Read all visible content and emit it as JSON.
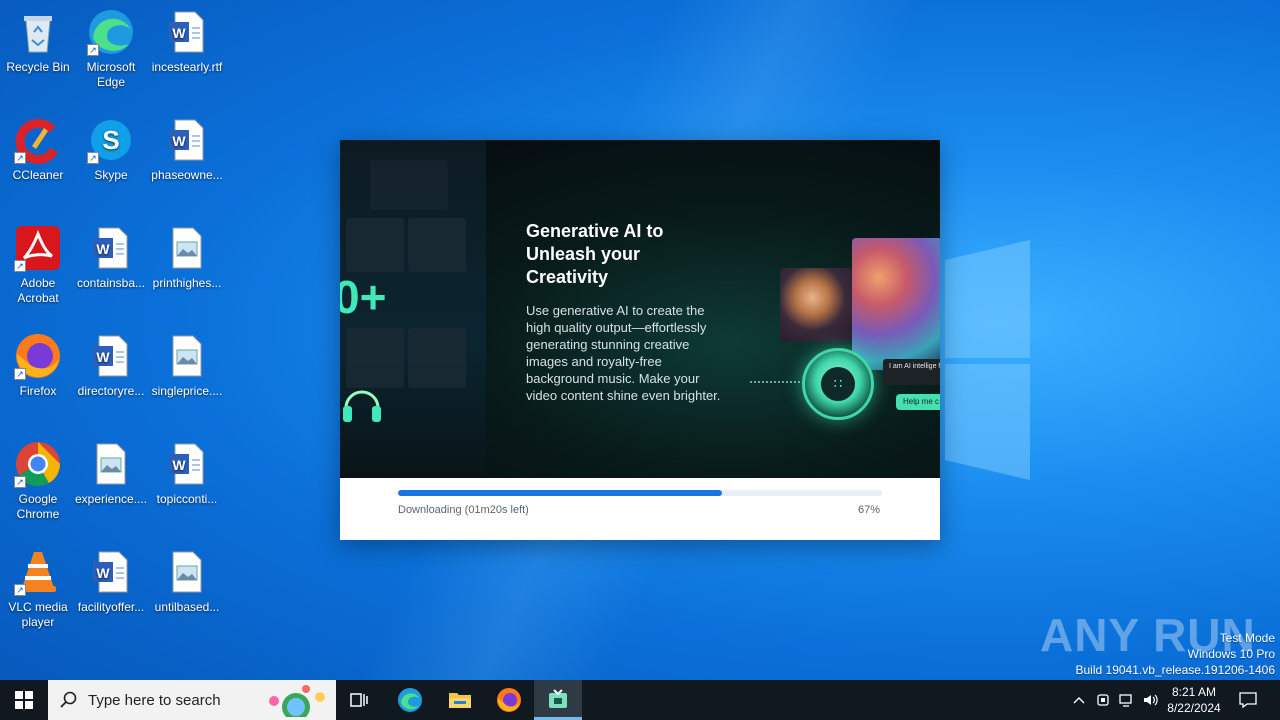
{
  "desktop": {
    "icons": [
      {
        "label": "Recycle Bin",
        "icon": "recycle-bin-icon"
      },
      {
        "label": "Microsoft Edge",
        "icon": "edge-icon"
      },
      {
        "label": "incestearly.rtf",
        "icon": "word-document-icon"
      },
      {
        "label": "CCleaner",
        "icon": "ccleaner-icon"
      },
      {
        "label": "Skype",
        "icon": "skype-icon"
      },
      {
        "label": "phaseowne...",
        "icon": "word-document-icon"
      },
      {
        "label": "Adobe Acrobat",
        "icon": "acrobat-icon"
      },
      {
        "label": "containsba...",
        "icon": "word-document-icon"
      },
      {
        "label": "printhighes...",
        "icon": "image-file-icon"
      },
      {
        "label": "Firefox",
        "icon": "firefox-icon"
      },
      {
        "label": "directoryre...",
        "icon": "word-document-icon"
      },
      {
        "label": "singleprice....",
        "icon": "image-file-icon"
      },
      {
        "label": "Google Chrome",
        "icon": "chrome-icon"
      },
      {
        "label": "experience....",
        "icon": "image-file-icon"
      },
      {
        "label": "topicconti...",
        "icon": "word-document-icon"
      },
      {
        "label": "VLC media player",
        "icon": "vlc-icon"
      },
      {
        "label": "facilityoffer...",
        "icon": "word-document-icon"
      },
      {
        "label": "untilbased...",
        "icon": "image-file-icon"
      }
    ]
  },
  "installer": {
    "big_count": "0+",
    "headline": "Generative AI to Unleash your Creativity",
    "body": "Use generative AI to create the high quality output—effortlessly generating stunning creative images and royalty-free background music. Make your video content shine even brighter.",
    "chat_bubble": "I am AI intellige how can I help",
    "chat_button": "Help me c",
    "progress_label": "Downloading (01m20s left)",
    "progress_percent_text": "67%",
    "progress_fraction": 0.67,
    "accent_color": "#1876e4"
  },
  "watermark": {
    "text": "ANY RUN"
  },
  "system_info": {
    "line1": "Test Mode",
    "line2": "Windows 10 Pro",
    "line3": "Build 19041.vb_release.191206-1406"
  },
  "taskbar": {
    "search_placeholder": "Type here to search",
    "time": "8:21 AM",
    "date": "8/22/2024",
    "apps": [
      "task-view-icon",
      "edge-icon",
      "file-explorer-icon",
      "firefox-icon",
      "installer-icon"
    ]
  }
}
